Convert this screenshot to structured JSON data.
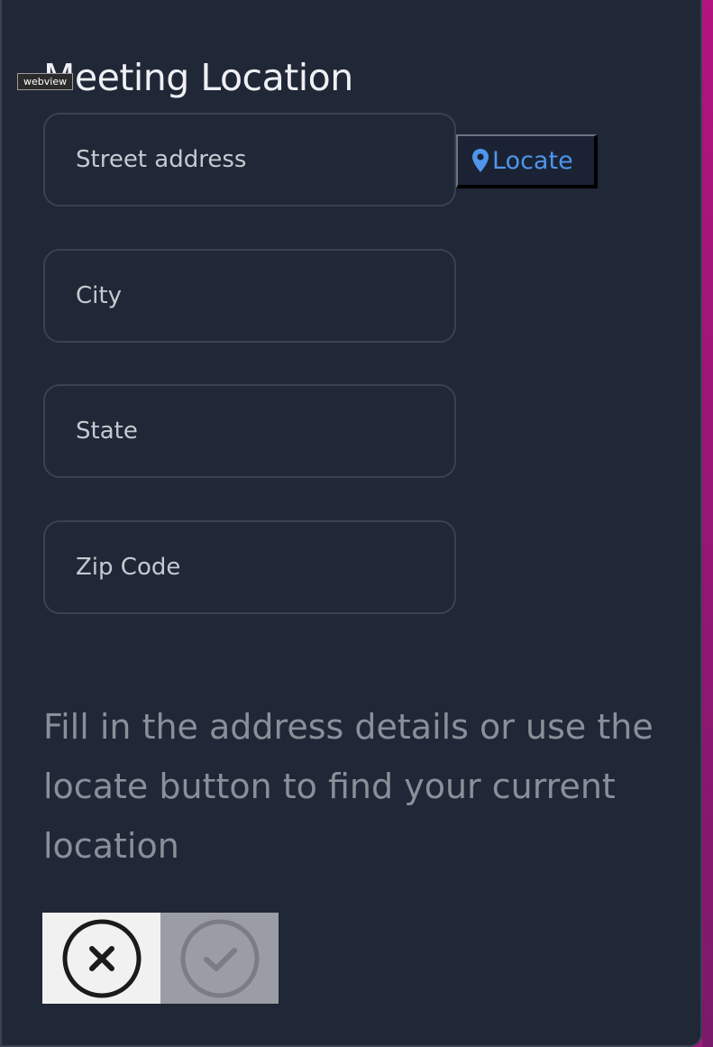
{
  "window": {
    "tag": "webview"
  },
  "title": "Meeting Location",
  "fields": {
    "street": {
      "placeholder": "Street address",
      "value": ""
    },
    "city": {
      "placeholder": "City",
      "value": ""
    },
    "state": {
      "placeholder": "State",
      "value": ""
    },
    "zip": {
      "placeholder": "Zip Code",
      "value": ""
    }
  },
  "locate_button": {
    "label": "Locate",
    "icon": "map-pin-icon",
    "color": "#4f95ec"
  },
  "hint": "Fill in the address details or use the locate button to find your current location",
  "actions": {
    "cancel": {
      "icon": "close-circle-icon",
      "enabled": true
    },
    "confirm": {
      "icon": "check-circle-icon",
      "enabled": false
    }
  },
  "colors": {
    "background": "#202736",
    "field_border": "#394152",
    "accent": "#4f95ec",
    "window_edge": "#a0187a"
  }
}
